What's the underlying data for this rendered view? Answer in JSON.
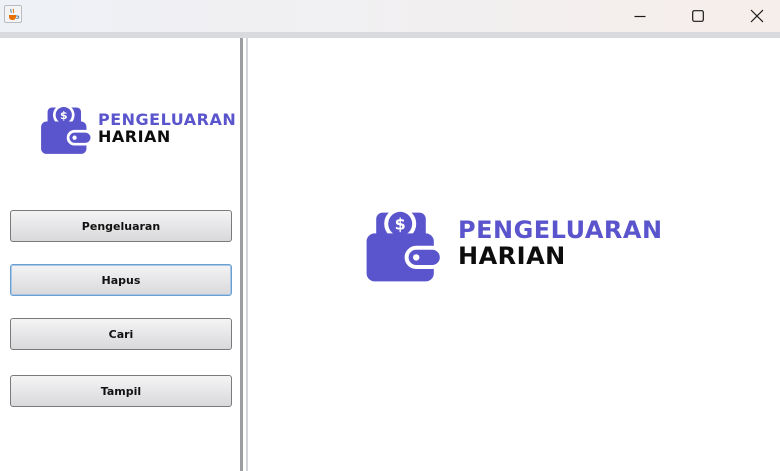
{
  "window": {
    "app_icon": "java-coffee-cup-icon",
    "controls": [
      "minimize-icon",
      "maximize-icon",
      "close-icon"
    ]
  },
  "sidebar": {
    "logo": {
      "line1": "PENGELUARAN",
      "line2": "HARIAN",
      "icon": "wallet-dollar-icon"
    },
    "buttons": [
      {
        "label": "Pengeluaran",
        "focused": false
      },
      {
        "label": "Hapus",
        "focused": true
      },
      {
        "label": "Cari",
        "focused": false
      },
      {
        "label": "Tampil",
        "focused": false
      }
    ]
  },
  "main": {
    "logo": {
      "line1": "PENGELUARAN",
      "line2": "HARIAN",
      "icon": "wallet-dollar-icon"
    }
  },
  "colors": {
    "brand_purple": "#5a55cc",
    "text_dark": "#0d0d0d"
  }
}
